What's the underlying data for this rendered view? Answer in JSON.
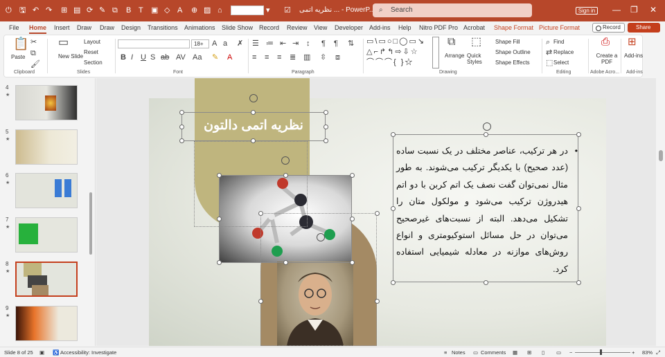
{
  "app": {
    "doc_title": "نظریه اتمی ... - PowerP...",
    "search_placeholder": "Search",
    "sign_in": "Sign in",
    "font_size_box": "",
    "record_label": "Record",
    "share_label": "Share",
    "brand_color": "#b7472a"
  },
  "menu": {
    "tabs": [
      "File",
      "Home",
      "Insert",
      "Draw",
      "Draw",
      "Design",
      "Transitions",
      "Animations",
      "Slide Show",
      "Record",
      "Review",
      "View",
      "Developer",
      "Add-ins",
      "Help",
      "Nitro PDF Pro",
      "Acrobat",
      "Shape Format",
      "Picture Format"
    ],
    "active": "Home"
  },
  "ribbon": {
    "clipboard": {
      "label": "Clipboard",
      "paste": "Paste"
    },
    "slides": {
      "label": "Slides",
      "new_slide": "New Slide",
      "layout": "Layout",
      "reset": "Reset",
      "section": "Section"
    },
    "font": {
      "label": "Font",
      "name": "",
      "size": "18+"
    },
    "paragraph": {
      "label": "Paragraph"
    },
    "drawing": {
      "label": "Drawing",
      "arrange": "Arrange",
      "quick_styles": "Quick Styles",
      "shape_fill": "Shape Fill",
      "shape_outline": "Shape Outline",
      "shape_effects": "Shape Effects"
    },
    "editing": {
      "label": "Editing",
      "find": "Find",
      "replace": "Replace",
      "select": "Select"
    },
    "adobe": {
      "label": "Adobe Acro...",
      "create_pdf": "Create a PDF"
    },
    "addins": {
      "label": "Add-ins",
      "addins": "Add-ins"
    }
  },
  "thumbnails": [
    {
      "num": "4",
      "star": "★"
    },
    {
      "num": "5",
      "star": "★"
    },
    {
      "num": "6",
      "star": "★"
    },
    {
      "num": "7",
      "star": "★"
    },
    {
      "num": "8",
      "star": "★",
      "selected": true
    },
    {
      "num": "9",
      "star": "★"
    }
  ],
  "slide": {
    "title": "نظریه اتمی دالتون",
    "body": "در هر ترکیب، عناصر مختلف در یک نسبت ساده (عدد صحیح) با یکدیگر ترکیب می‌شوند. به طور مثال نمی‌توان گفت نصف یک اتم کربن با دو اتم هیدروژن ترکیب می‌شود و مولکول متان را تشکیل می‌دهد. البته از نسبت‌های غیرصحیح می‌توان در حل مسائل استوکیومتری و انواع روش‌های موازنه در معادله شیمیایی استفاده کرد."
  },
  "status": {
    "slide_info": "Slide 8 of 25",
    "accessibility": "Accessibility: Investigate",
    "notes": "Notes",
    "comments": "Comments",
    "zoom": "83%"
  }
}
